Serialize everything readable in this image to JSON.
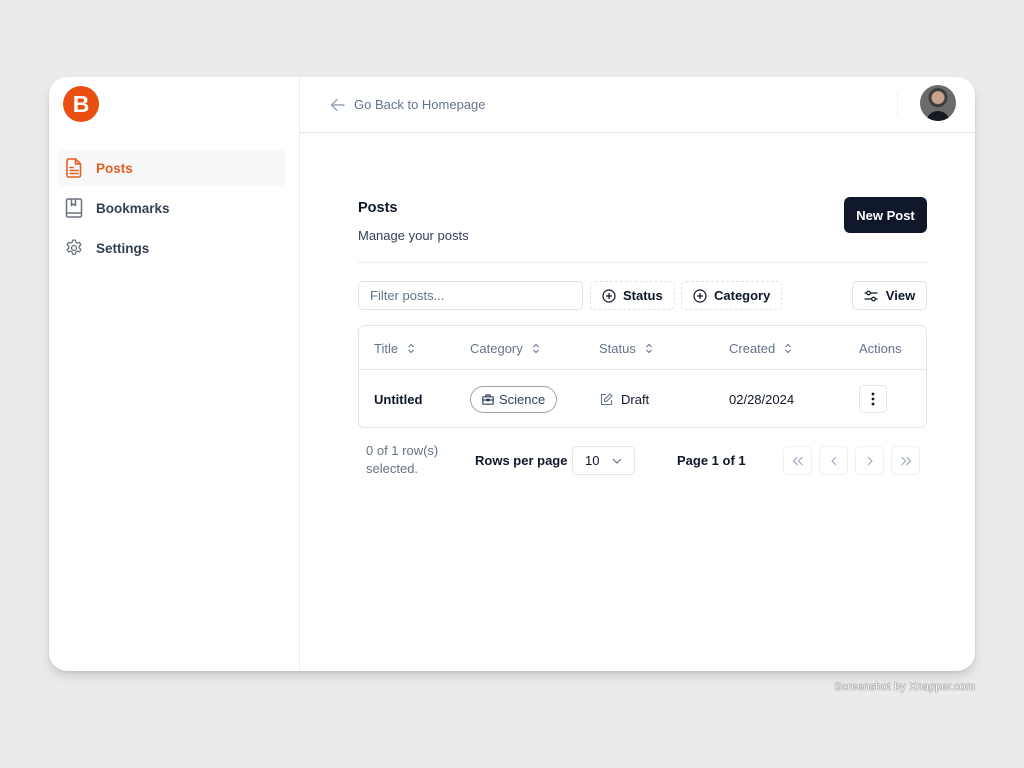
{
  "brand": {
    "logo_letter": "B",
    "accent": "#ea4f12"
  },
  "sidebar": {
    "items": [
      {
        "label": "Posts",
        "icon": "file-text-icon",
        "active": true
      },
      {
        "label": "Bookmarks",
        "icon": "book-icon",
        "active": false
      },
      {
        "label": "Settings",
        "icon": "gear-icon",
        "active": false
      }
    ]
  },
  "topbar": {
    "back_label": "Go Back to Homepage",
    "back_icon": "arrow-left-icon",
    "avatar": "user-avatar"
  },
  "page": {
    "title": "Posts",
    "subtitle": "Manage your posts",
    "new_post_label": "New Post"
  },
  "toolbar": {
    "filter_placeholder": "Filter posts...",
    "filter_value": "",
    "status_label": "Status",
    "category_label": "Category",
    "view_label": "View"
  },
  "table": {
    "columns": [
      "Title",
      "Category",
      "Status",
      "Created",
      "Actions"
    ],
    "rows": [
      {
        "title": "Untitled",
        "category": "Science",
        "status": "Draft",
        "created": "02/28/2024"
      }
    ]
  },
  "pagination": {
    "selected_text": "0 of 1 row(s) selected.",
    "rows_per_page_label": "Rows per page",
    "rows_per_page_value": "10",
    "page_info": "Page 1 of 1"
  },
  "watermark": "Screenshot by Xnapper.com"
}
